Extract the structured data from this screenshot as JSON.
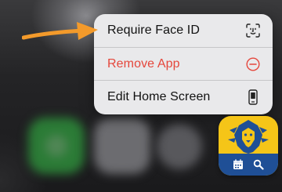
{
  "menu": {
    "items": [
      {
        "label": "Require Face ID",
        "icon": "face-id-icon",
        "destructive": false
      },
      {
        "label": "Remove App",
        "icon": "minus-circle-icon",
        "destructive": true
      },
      {
        "label": "Edit Home Screen",
        "icon": "phone-device-icon",
        "destructive": false
      }
    ]
  },
  "colors": {
    "destructive": "#e5473c",
    "arrow": "#f39a2b",
    "menu_background": "#e9e9eb",
    "app_icon_yellow": "#f5c518",
    "app_icon_blue": "#1f4f96"
  },
  "app_icon": {
    "icons": [
      "lion-logo-icon",
      "calendar-icon",
      "search-icon"
    ]
  },
  "background_apps": [
    "phone-app-icon",
    "safari-app-icon",
    "camera-app-icon"
  ]
}
